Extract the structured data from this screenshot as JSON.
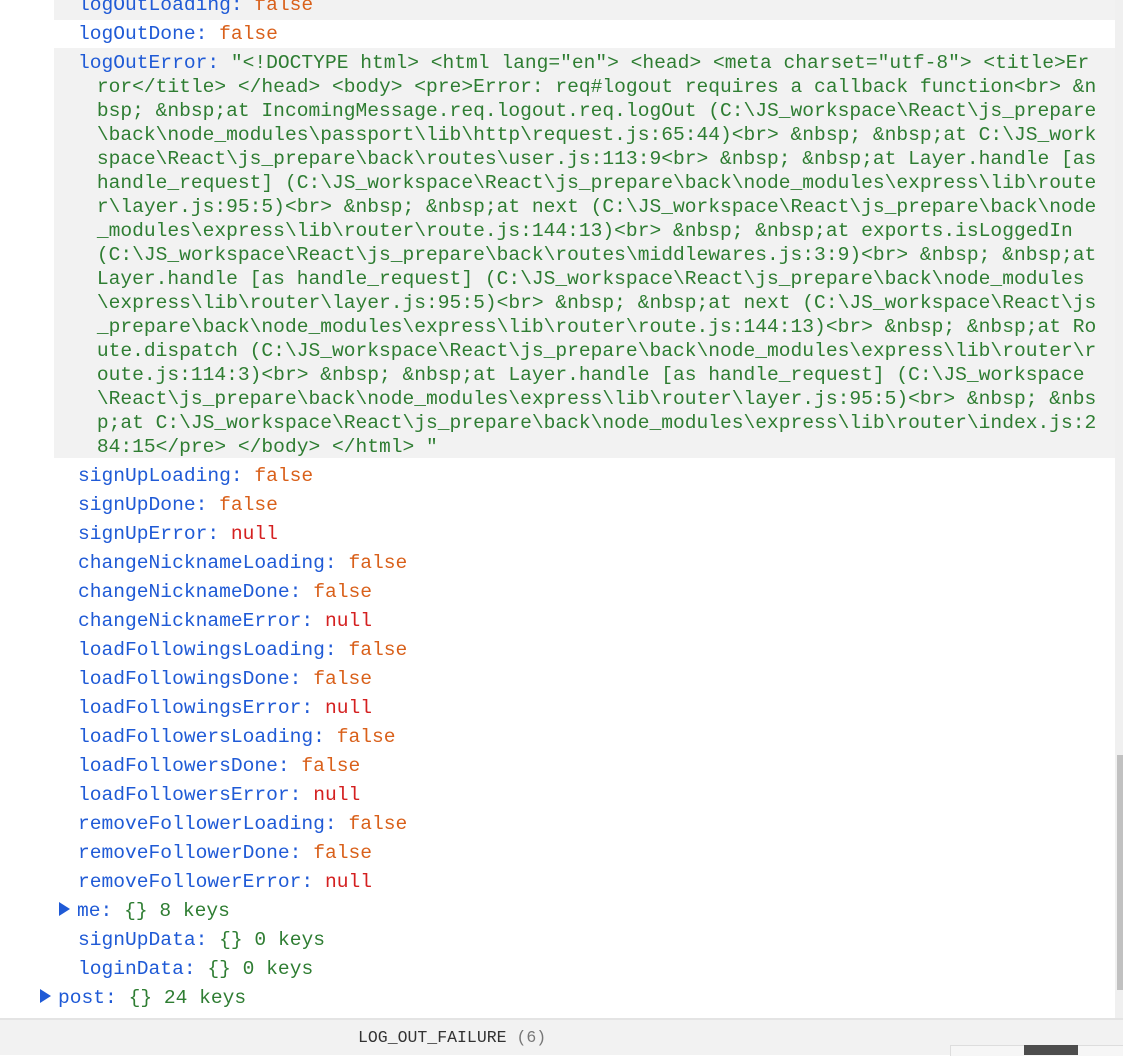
{
  "user_fields_top": [
    {
      "key": "logOutLoading",
      "value": "false",
      "type": "bool"
    },
    {
      "key": "logOutDone",
      "value": "false",
      "type": "bool"
    }
  ],
  "log_out_error": {
    "key": "logOutError",
    "value": "\"<!DOCTYPE html> <html lang=\"en\"> <head> <meta charset=\"utf-8\"> <title>Error</title> </head> <body> <pre>Error: req#logout requires a callback function<br> &nbsp; &nbsp;at IncomingMessage.req.logout.req.logOut (C:\\JS_workspace\\React\\js_prepare\\back\\node_modules\\passport\\lib\\http\\request.js:65:44)<br> &nbsp; &nbsp;at C:\\JS_workspace\\React\\js_prepare\\back\\routes\\user.js:113:9<br> &nbsp; &nbsp;at Layer.handle [as handle_request] (C:\\JS_workspace\\React\\js_prepare\\back\\node_modules\\express\\lib\\router\\layer.js:95:5)<br> &nbsp; &nbsp;at next (C:\\JS_workspace\\React\\js_prepare\\back\\node_modules\\express\\lib\\router\\route.js:144:13)<br> &nbsp; &nbsp;at exports.isLoggedIn (C:\\JS_workspace\\React\\js_prepare\\back\\routes\\middlewares.js:3:9)<br> &nbsp; &nbsp;at Layer.handle [as handle_request] (C:\\JS_workspace\\React\\js_prepare\\back\\node_modules\\express\\lib\\router\\layer.js:95:5)<br> &nbsp; &nbsp;at next (C:\\JS_workspace\\React\\js_prepare\\back\\node_modules\\express\\lib\\router\\route.js:144:13)<br> &nbsp; &nbsp;at Route.dispatch (C:\\JS_workspace\\React\\js_prepare\\back\\node_modules\\express\\lib\\router\\route.js:114:3)<br> &nbsp; &nbsp;at Layer.handle [as handle_request] (C:\\JS_workspace\\React\\js_prepare\\back\\node_modules\\express\\lib\\router\\layer.js:95:5)<br> &nbsp; &nbsp;at C:\\JS_workspace\\React\\js_prepare\\back\\node_modules\\express\\lib\\router\\index.js:284:15</pre> </body> </html> \""
  },
  "user_fields": [
    {
      "key": "signUpLoading",
      "value": "false",
      "type": "bool"
    },
    {
      "key": "signUpDone",
      "value": "false",
      "type": "bool"
    },
    {
      "key": "signUpError",
      "value": "null",
      "type": "null"
    },
    {
      "key": "changeNicknameLoading",
      "value": "false",
      "type": "bool"
    },
    {
      "key": "changeNicknameDone",
      "value": "false",
      "type": "bool"
    },
    {
      "key": "changeNicknameError",
      "value": "null",
      "type": "null"
    },
    {
      "key": "loadFollowingsLoading",
      "value": "false",
      "type": "bool"
    },
    {
      "key": "loadFollowingsDone",
      "value": "false",
      "type": "bool"
    },
    {
      "key": "loadFollowingsError",
      "value": "null",
      "type": "null"
    },
    {
      "key": "loadFollowersLoading",
      "value": "false",
      "type": "bool"
    },
    {
      "key": "loadFollowersDone",
      "value": "false",
      "type": "bool"
    },
    {
      "key": "loadFollowersError",
      "value": "null",
      "type": "null"
    },
    {
      "key": "removeFollowerLoading",
      "value": "false",
      "type": "bool"
    },
    {
      "key": "removeFollowerDone",
      "value": "false",
      "type": "bool"
    },
    {
      "key": "removeFollowerError",
      "value": "null",
      "type": "null"
    }
  ],
  "objects": [
    {
      "key": "me",
      "braces": "{}",
      "count": "8 keys",
      "expandable": true
    },
    {
      "key": "signUpData",
      "braces": "{}",
      "count": "0 keys",
      "expandable": false
    },
    {
      "key": "loginData",
      "braces": "{}",
      "count": "0 keys",
      "expandable": false
    }
  ],
  "root_objects": [
    {
      "key": "post",
      "braces": "{}",
      "count": "24 keys",
      "expandable": true
    }
  ],
  "action_bar": {
    "action": "LOG_OUT_FAILURE",
    "count": "(6)"
  },
  "colors": {
    "key": "#1f5ad6",
    "bool": "#d9601a",
    "null": "#d42020",
    "string": "#2e7d32"
  }
}
